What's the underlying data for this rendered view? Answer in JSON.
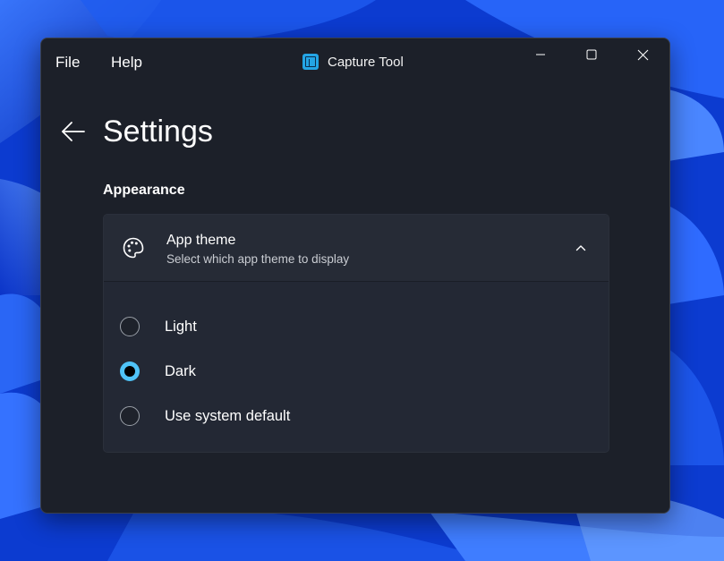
{
  "menu": {
    "file": "File",
    "help": "Help"
  },
  "titlebar": {
    "app_name": "Capture Tool",
    "app_icon": "capture-tool-icon",
    "minimize_icon": "minimize-icon",
    "maximize_icon": "maximize-icon",
    "close_icon": "close-icon"
  },
  "page": {
    "back_icon": "arrow-left-icon",
    "title": "Settings",
    "section_title": "Appearance"
  },
  "theme_setting": {
    "icon": "palette-icon",
    "title": "App theme",
    "description": "Select which app theme to display",
    "expanded": true,
    "options": [
      {
        "label": "Light",
        "selected": false
      },
      {
        "label": "Dark",
        "selected": true
      },
      {
        "label": "Use system default",
        "selected": false
      }
    ]
  },
  "colors": {
    "window_bg": "#1c2029",
    "card_bg": "#232834",
    "accent": "#4fc3f7",
    "desktop": "#0d3fd6"
  }
}
